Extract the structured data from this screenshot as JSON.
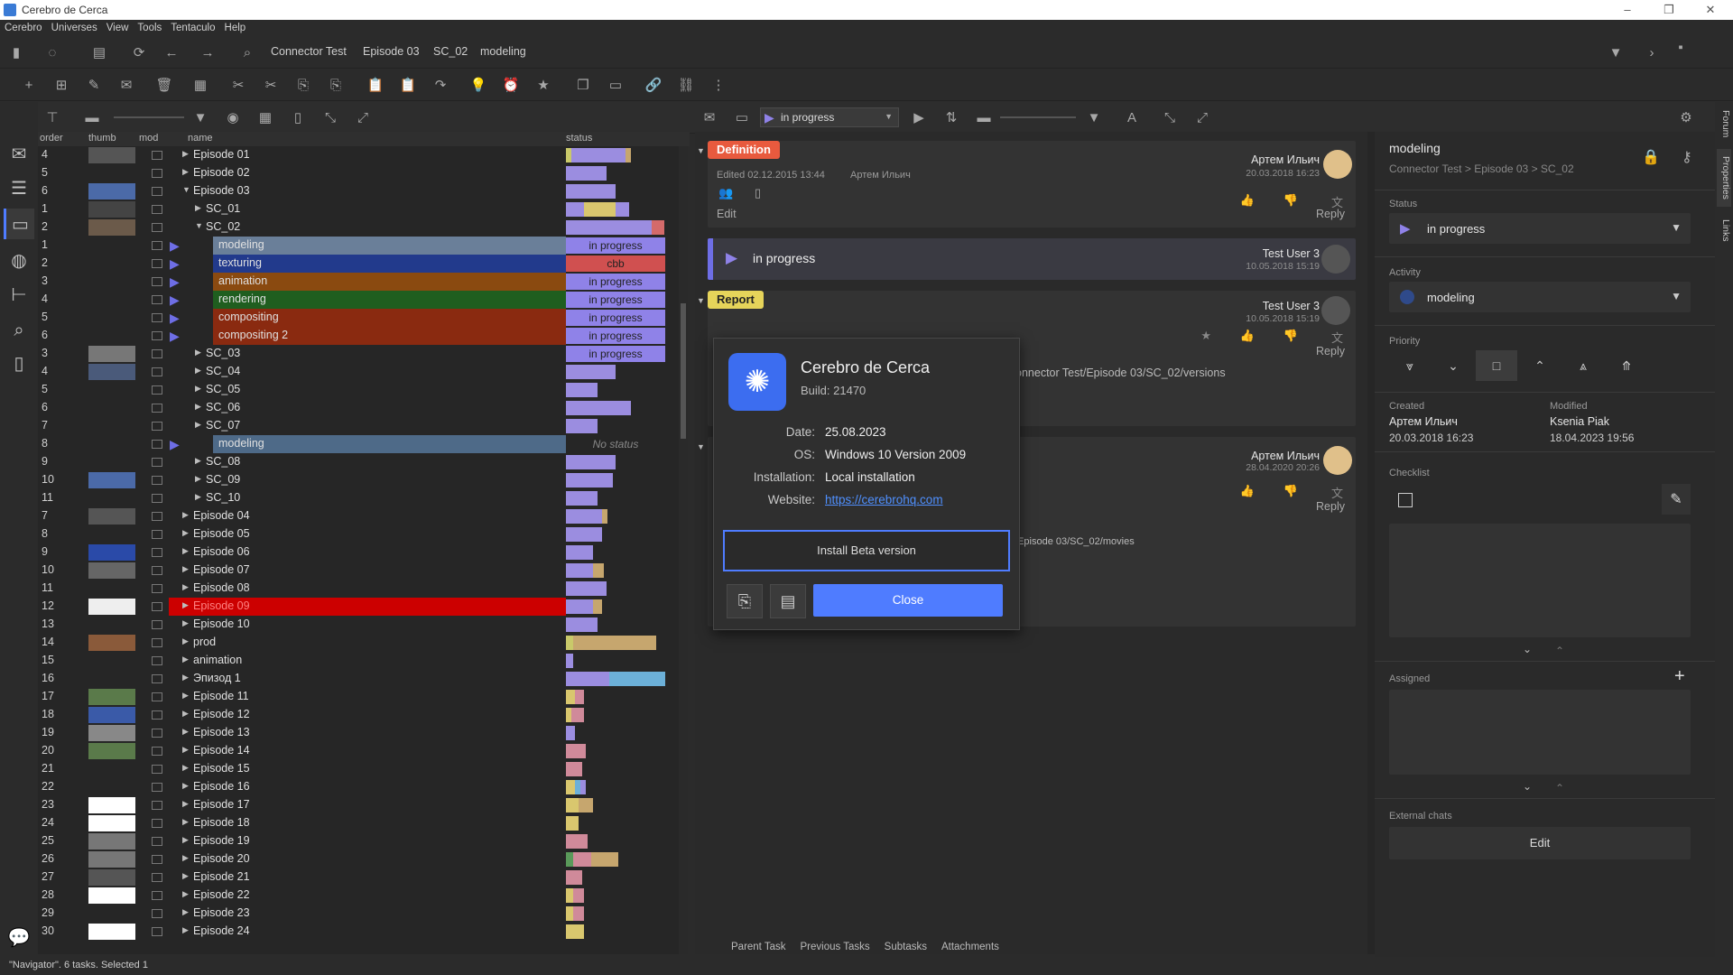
{
  "window": {
    "title": "Cerebro de Cerca",
    "controls": [
      "–",
      "❐",
      "✕"
    ]
  },
  "menu": [
    "Cerebro",
    "Universes",
    "View",
    "Tools",
    "Tentaculo",
    "Help"
  ],
  "breadcrumbs": [
    "Connector Test",
    "Episode 03",
    "SC_02",
    "modeling"
  ],
  "toolbar3": {
    "status_filter": "in progress"
  },
  "tree": {
    "headers": {
      "order": "order",
      "thumb": "thumb",
      "mod": "mod",
      "name": "name",
      "status": "status"
    },
    "rows": [
      {
        "num": "4",
        "name": "Episode 01",
        "indent": 0,
        "expand": "closed",
        "thumb": "#555",
        "bars": [
          [
            "#c9c96a",
            6
          ],
          [
            "#9b8de0",
            60
          ],
          [
            "#c6a66e",
            6
          ]
        ]
      },
      {
        "num": "5",
        "name": "Episode 02",
        "indent": 0,
        "expand": "closed",
        "thumb": "",
        "bars": [
          [
            "#9b8de0",
            45
          ]
        ]
      },
      {
        "num": "6",
        "name": "Episode 03",
        "indent": 0,
        "expand": "open",
        "thumb": "#4b6aa8",
        "bars": [
          [
            "#9b8de0",
            55
          ]
        ]
      },
      {
        "num": "1",
        "name": "SC_01",
        "indent": 1,
        "expand": "closed",
        "thumb": "#444",
        "bars": [
          [
            "#9b8de0",
            20
          ],
          [
            "#d9c76e",
            35
          ],
          [
            "#9b8de0",
            15
          ]
        ]
      },
      {
        "num": "2",
        "name": "SC_02",
        "indent": 1,
        "expand": "open",
        "thumb": "#6b5a4a",
        "bars": [
          [
            "#9b8de0",
            95
          ],
          [
            "#d46a6a",
            14
          ]
        ]
      },
      {
        "num": "1",
        "name": "modeling",
        "indent": 2,
        "task": true,
        "highlight": "#6a7f99",
        "status": "in progress",
        "stcolor": "#8f82e8"
      },
      {
        "num": "2",
        "name": "texturing",
        "indent": 2,
        "task": true,
        "highlight": "#223a8c",
        "status": "cbb",
        "stcolor": "#d05050"
      },
      {
        "num": "3",
        "name": "animation",
        "indent": 2,
        "task": true,
        "highlight": "#8a4a10",
        "status": "in progress",
        "stcolor": "#8f82e8"
      },
      {
        "num": "4",
        "name": "rendering",
        "indent": 2,
        "task": true,
        "highlight": "#1f5e1f",
        "status": "in progress",
        "stcolor": "#8f82e8"
      },
      {
        "num": "5",
        "name": "compositing",
        "indent": 2,
        "task": true,
        "highlight": "#8a2a10",
        "status": "in progress",
        "stcolor": "#8f82e8"
      },
      {
        "num": "6",
        "name": "compositing 2",
        "indent": 2,
        "task": true,
        "highlight": "#8a2a10",
        "status": "in progress",
        "stcolor": "#8f82e8"
      },
      {
        "num": "3",
        "name": "SC_03",
        "indent": 1,
        "expand": "closed",
        "thumb": "#777",
        "status": "in progress",
        "stcolor": "#8f82e8"
      },
      {
        "num": "4",
        "name": "SC_04",
        "indent": 1,
        "expand": "closed",
        "thumb": "#4a5a7a",
        "bars": [
          [
            "#9b8de0",
            55
          ]
        ]
      },
      {
        "num": "5",
        "name": "SC_05",
        "indent": 1,
        "expand": "closed",
        "thumb": "",
        "bars": [
          [
            "#9b8de0",
            35
          ]
        ]
      },
      {
        "num": "6",
        "name": "SC_06",
        "indent": 1,
        "expand": "closed",
        "thumb": "",
        "bars": [
          [
            "#9b8de0",
            72
          ]
        ]
      },
      {
        "num": "7",
        "name": "SC_07",
        "indent": 1,
        "expand": "closed",
        "thumb": "",
        "bars": [
          [
            "#9b8de0",
            35
          ]
        ]
      },
      {
        "num": "8",
        "name": "modeling",
        "indent": 2,
        "task": true,
        "highlight": "#4e6a88",
        "status": "No status",
        "stcolor": "none"
      },
      {
        "num": "9",
        "name": "SC_08",
        "indent": 1,
        "expand": "closed",
        "thumb": "",
        "bars": [
          [
            "#9b8de0",
            55
          ]
        ]
      },
      {
        "num": "10",
        "name": "SC_09",
        "indent": 1,
        "expand": "closed",
        "thumb": "#4b6aa8",
        "bars": [
          [
            "#9b8de0",
            52
          ]
        ]
      },
      {
        "num": "11",
        "name": "SC_10",
        "indent": 1,
        "expand": "closed",
        "thumb": "",
        "bars": [
          [
            "#9b8de0",
            35
          ]
        ]
      },
      {
        "num": "7",
        "name": "Episode 04",
        "indent": 0,
        "expand": "closed",
        "thumb": "#555",
        "bars": [
          [
            "#9b8de0",
            40
          ],
          [
            "#c6a66e",
            6
          ]
        ]
      },
      {
        "num": "8",
        "name": "Episode 05",
        "indent": 0,
        "expand": "closed",
        "thumb": "",
        "bars": [
          [
            "#9b8de0",
            40
          ]
        ]
      },
      {
        "num": "9",
        "name": "Episode 06",
        "indent": 0,
        "expand": "closed",
        "thumb": "#2a4aa8",
        "bars": [
          [
            "#9b8de0",
            30
          ]
        ]
      },
      {
        "num": "10",
        "name": "Episode 07",
        "indent": 0,
        "expand": "closed",
        "thumb": "#666",
        "bars": [
          [
            "#9b8de0",
            30
          ],
          [
            "#c6a66e",
            12
          ]
        ]
      },
      {
        "num": "11",
        "name": "Episode 08",
        "indent": 0,
        "expand": "closed",
        "thumb": "",
        "bars": [
          [
            "#9b8de0",
            45
          ]
        ]
      },
      {
        "num": "12",
        "name": "Episode 09",
        "indent": 0,
        "expand": "closed",
        "thumb": "#eee",
        "highlight": "#cc0000",
        "redtext": true,
        "bars": [
          [
            "#9b8de0",
            30
          ],
          [
            "#c6a66e",
            10
          ]
        ]
      },
      {
        "num": "13",
        "name": "Episode 10",
        "indent": 0,
        "expand": "closed",
        "thumb": "",
        "bars": [
          [
            "#9b8de0",
            35
          ]
        ]
      },
      {
        "num": "14",
        "name": "prod",
        "indent": 0,
        "expand": "closed",
        "thumb": "#8a5a3a",
        "bars": [
          [
            "#c9c96a",
            8
          ],
          [
            "#c6a66e",
            92
          ]
        ]
      },
      {
        "num": "15",
        "name": "animation",
        "indent": 0,
        "expand": "closed",
        "thumb": "",
        "bars": [
          [
            "#9b8de0",
            8
          ]
        ]
      },
      {
        "num": "16",
        "name": "Эпизод 1",
        "indent": 0,
        "expand": "closed",
        "thumb": "",
        "bars": [
          [
            "#9b8de0",
            48
          ],
          [
            "#6cb0d8",
            62
          ]
        ]
      },
      {
        "num": "17",
        "name": "Episode 11",
        "indent": 0,
        "expand": "closed",
        "thumb": "#5a7a4a",
        "bars": [
          [
            "#d9c76e",
            10
          ],
          [
            "#d08a9a",
            10
          ]
        ]
      },
      {
        "num": "18",
        "name": "Episode 12",
        "indent": 0,
        "expand": "closed",
        "thumb": "#3a5aa8",
        "bars": [
          [
            "#d9c76e",
            6
          ],
          [
            "#d08a9a",
            14
          ]
        ]
      },
      {
        "num": "19",
        "name": "Episode 13",
        "indent": 0,
        "expand": "closed",
        "thumb": "#888",
        "bars": [
          [
            "#9b8de0",
            10
          ]
        ]
      },
      {
        "num": "20",
        "name": "Episode 14",
        "indent": 0,
        "expand": "closed",
        "thumb": "#5a7a4a",
        "bars": [
          [
            "#d08a9a",
            22
          ]
        ]
      },
      {
        "num": "21",
        "name": "Episode 15",
        "indent": 0,
        "expand": "closed",
        "thumb": "",
        "bars": [
          [
            "#d08a9a",
            18
          ]
        ]
      },
      {
        "num": "22",
        "name": "Episode 16",
        "indent": 0,
        "expand": "closed",
        "thumb": "",
        "bars": [
          [
            "#d9c76e",
            10
          ],
          [
            "#6cb0d8",
            6
          ],
          [
            "#9b8de0",
            6
          ]
        ]
      },
      {
        "num": "23",
        "name": "Episode 17",
        "indent": 0,
        "expand": "closed",
        "thumb": "#fff",
        "bars": [
          [
            "#d9c76e",
            14
          ],
          [
            "#c6a66e",
            16
          ]
        ]
      },
      {
        "num": "24",
        "name": "Episode 18",
        "indent": 0,
        "expand": "closed",
        "thumb": "#fff",
        "bars": [
          [
            "#d9c76e",
            14
          ]
        ]
      },
      {
        "num": "25",
        "name": "Episode 19",
        "indent": 0,
        "expand": "closed",
        "thumb": "#777",
        "bars": [
          [
            "#d08a9a",
            24
          ]
        ]
      },
      {
        "num": "26",
        "name": "Episode 20",
        "indent": 0,
        "expand": "closed",
        "thumb": "#777",
        "bars": [
          [
            "#5a9a5a",
            8
          ],
          [
            "#d08a9a",
            20
          ],
          [
            "#c6a66e",
            30
          ]
        ]
      },
      {
        "num": "27",
        "name": "Episode 21",
        "indent": 0,
        "expand": "closed",
        "thumb": "#555",
        "bars": [
          [
            "#d08a9a",
            18
          ]
        ]
      },
      {
        "num": "28",
        "name": "Episode 22",
        "indent": 0,
        "expand": "closed",
        "thumb": "#fff",
        "bars": [
          [
            "#d9c76e",
            8
          ],
          [
            "#d08a9a",
            12
          ]
        ]
      },
      {
        "num": "29",
        "name": "Episode 23",
        "indent": 0,
        "expand": "closed",
        "thumb": "",
        "bars": [
          [
            "#d9c76e",
            8
          ],
          [
            "#d08a9a",
            12
          ]
        ]
      },
      {
        "num": "30",
        "name": "Episode 24",
        "indent": 0,
        "expand": "closed",
        "thumb": "#fff",
        "bars": [
          [
            "#d9c76e",
            20
          ]
        ]
      }
    ]
  },
  "messages": {
    "definition": {
      "tag": "Definition",
      "edited": "Edited 02.12.2015 13:44",
      "edited_by": "Артем Ильич",
      "author": "Артем Ильич",
      "date": "20.03.2018 16:23",
      "edit": "Edit",
      "reply": "Reply"
    },
    "status_change": {
      "text": "in progress",
      "author": "Test User 3",
      "date": "10.05.2018 15:19"
    },
    "report": {
      "tag": "Report",
      "author": "Test User 3",
      "date": "10.05.2018 15:19",
      "reply": "Reply",
      "path": "Connector Test/Episode 03/SC_02/versions"
    },
    "third": {
      "author": "Артем Ильич",
      "date": "28.04.2020 20:26",
      "reply": "Reply",
      "path": "/Episode 03/SC_02/movies"
    }
  },
  "center_tabs": [
    "Parent Task",
    "Previous Tasks",
    "Subtasks",
    "Attachments"
  ],
  "dialog": {
    "app_name": "Cerebro de Cerca",
    "build": "Build: 21470",
    "fields": [
      {
        "label": "Date:",
        "value": "25.08.2023"
      },
      {
        "label": "OS:",
        "value": "Windows 10 Version 2009"
      },
      {
        "label": "Installation:",
        "value": "Local installation"
      },
      {
        "label": "Website:",
        "value": "https://cerebrohq.com"
      }
    ],
    "beta_button": "Install Beta version",
    "close_button": "Close"
  },
  "properties": {
    "title": "modeling",
    "path": [
      "Connector Test",
      "Episode 03",
      "SC_02"
    ],
    "status_label": "Status",
    "status_value": "in progress",
    "activity_label": "Activity",
    "activity_value": "modeling",
    "priority_label": "Priority",
    "created_label": "Created",
    "created_by": "Артем Ильич",
    "created_date": "20.03.2018 16:23",
    "modified_label": "Modified",
    "modified_by": "Ksenia Piak",
    "modified_date": "18.04.2023 19:56",
    "checklist_label": "Checklist",
    "assigned_label": "Assigned",
    "external_chats_label": "External chats",
    "external_chats_button": "Edit"
  },
  "vertical_tabs": [
    "Forum",
    "Properties",
    "Links"
  ],
  "status_bar": "\"Navigator\". 6 tasks. Selected 1",
  "colors": {
    "accent": "#4f7cff",
    "in_progress": "#8f82e8",
    "cbb": "#d05050"
  }
}
